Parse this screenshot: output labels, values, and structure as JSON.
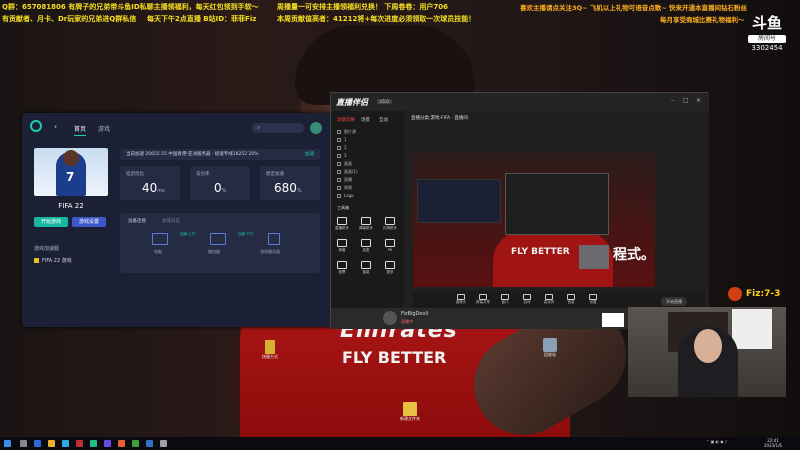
{
  "overlay": {
    "line1": [
      {
        "text": "Q群：657081806 有牌子的兄弟带斗鱼ID私聊主播领福利，每天红包领到手软～",
        "color": "#f5e020"
      },
      {
        "text": "周播量一可安排主播领福利兑换！  下周卷卷：用户706",
        "color": "#f5e020"
      },
      {
        "text": "喜欢主播请点关注3Q~ 飞机以上礼物可语音点歌~ 快来开通本直播间钻石粉丝",
        "color": "#ffb020"
      }
    ],
    "line2": [
      {
        "text": "有贡献者、月卡、Dr玩家的兄弟进Q群私信",
        "color": "#f5e020"
      },
      {
        "text": "每天下午2点直播  B站ID：菲菲Fiz",
        "color": "#f5e020"
      },
      {
        "text": "本周贡献值高者：41212将+每次进度必须领取一次球员技能！",
        "color": "#f5e020"
      },
      {
        "text": "每月享受商城比赛礼物福利～",
        "color": "#ffb020"
      }
    ]
  },
  "watermark": {
    "logo": "斗鱼",
    "label": "房间号",
    "room": "3302454"
  },
  "jersey": {
    "text1": "Emirates",
    "text2": "FLY BETTER"
  },
  "left_app": {
    "tabs": [
      "首页",
      "游戏"
    ],
    "game_title": "FIFA 22",
    "card_number": "7",
    "btn_primary": "开始游戏",
    "btn_secondary": "游戏设置",
    "side_label": "游戏加速服",
    "side_item": "FIFA 22 游戏",
    "info_text": "当前加速 20655.55  中国香港-亚洲服务器 · 极速专线18252   20%",
    "info_link": "加速",
    "stats": [
      {
        "label": "延迟优化",
        "value": "40",
        "unit": "ms"
      },
      {
        "label": "丢包率",
        "value": "0",
        "unit": "%"
      },
      {
        "label": "稳定加速",
        "value": "680",
        "unit": "%"
      }
    ],
    "panel_tab1": "设备连接",
    "panel_tab2": "加速日志",
    "devices": [
      {
        "label": "电脑",
        "sub": "加速·上行"
      },
      {
        "label": "路由器",
        "sub": "加速·下行"
      },
      {
        "label": "游戏服务器",
        "sub": ""
      }
    ]
  },
  "browser": {
    "logo": "直播伴侣",
    "version": "v5.0",
    "sidebar_tabs": [
      "场景切换",
      "场景",
      "互动"
    ],
    "sidebar_rows": [
      "图片源",
      "1",
      "2",
      "3",
      "画面",
      "画面(1)",
      "直播",
      "视频",
      "Logo"
    ],
    "tools_label": "工具箱",
    "tools": [
      "直播助手",
      "弹幕助手",
      "礼物助手",
      "房管",
      "连麦",
      "PK",
      "投票",
      "抽奖",
      "更多"
    ],
    "main_title": "直播分类:游戏·FIFA · 直播间",
    "preview_big_text": "程式。",
    "preview_jersey": "FLY BETTER",
    "controls": [
      "摄像头",
      "屏幕共享",
      "窗口",
      "游戏",
      "麦克风",
      "音量",
      "设置"
    ],
    "start_label": "开始直播",
    "profile_name": "FizBigDevil",
    "profile_sub": "直播中"
  },
  "webcam": {
    "score": "Fiz:7-3"
  },
  "desktop_icons": [
    {
      "name": "回收站"
    },
    {
      "name": "新建文件夹"
    },
    {
      "name": "快捷方式"
    }
  ],
  "taskbar": {
    "clock_time": "22:41",
    "clock_date": "2023/1/6"
  }
}
